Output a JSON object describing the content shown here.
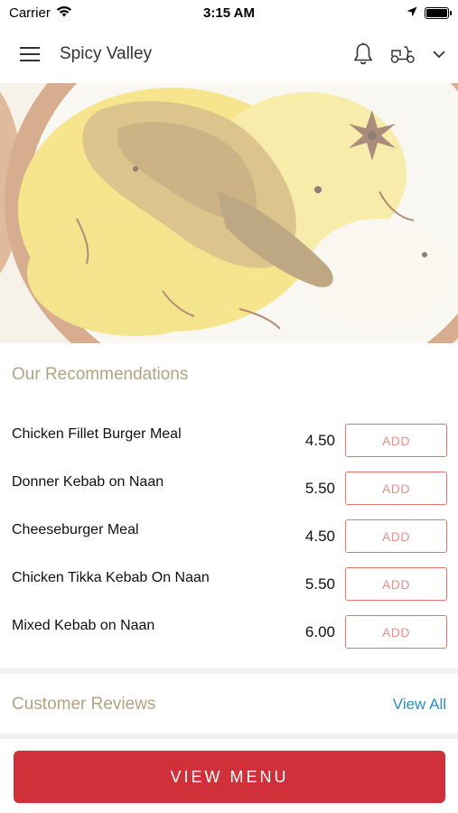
{
  "status_bar": {
    "carrier": "Carrier",
    "time": "3:15 AM"
  },
  "header": {
    "title": "Spicy Valley",
    "icons": [
      "menu-icon",
      "bell-icon",
      "scooter-icon",
      "chevron-down-icon"
    ]
  },
  "hero": {
    "image": "biryani-bowl"
  },
  "recommendations": {
    "title": "Our Recommendations",
    "items": [
      {
        "name": "Chicken Fillet Burger Meal",
        "price": "4.50",
        "action": "ADD"
      },
      {
        "name": "Donner Kebab on Naan",
        "price": "5.50",
        "action": "ADD"
      },
      {
        "name": "Cheeseburger Meal",
        "price": "4.50",
        "action": "ADD"
      },
      {
        "name": "Chicken Tikka Kebab On Naan",
        "price": "5.50",
        "action": "ADD"
      },
      {
        "name": "Mixed Kebab on Naan",
        "price": "6.00",
        "action": "ADD"
      }
    ]
  },
  "reviews": {
    "title": "Customer Reviews",
    "view_all": "View All"
  },
  "footer": {
    "button_label": "VIEW MENU"
  },
  "colors": {
    "accent": "#d0303a",
    "section_title": "#b3a27f",
    "link": "#2a8fbf",
    "add_border": "#e57373"
  }
}
